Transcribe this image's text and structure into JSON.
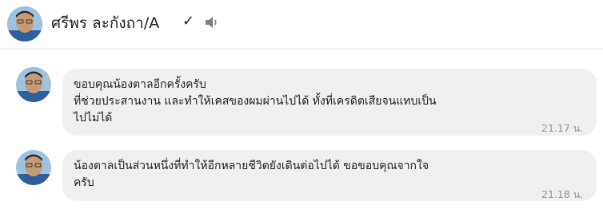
{
  "contact": {
    "name": "ศรีพร ละกังถา/A",
    "verified_glyph": "✓",
    "speaker_icon": "speaker-icon"
  },
  "messages": [
    {
      "lines": [
        "ขอบคุณน้องตาลอีกครั้งครับ",
        "ที่ช่วยประสานงาน   และทำให้เคสของผมผ่านไปได้   ทั้งที่เครดิตเสียจนแทบเป็น",
        "ไปไม่ได้"
      ],
      "time": "21.17 น."
    },
    {
      "lines": [
        "น้องตาลเป็นส่วนหนึ่งที่ทำให้อีกหลายชีวิตยังเดินต่อไปได้   ขอขอบคุณจากใจ",
        "ครับ"
      ],
      "time": "21.18 น."
    }
  ],
  "colors": {
    "bubble": "#f1f0f0",
    "timestamp": "#90949c",
    "text": "#1c1e21"
  }
}
